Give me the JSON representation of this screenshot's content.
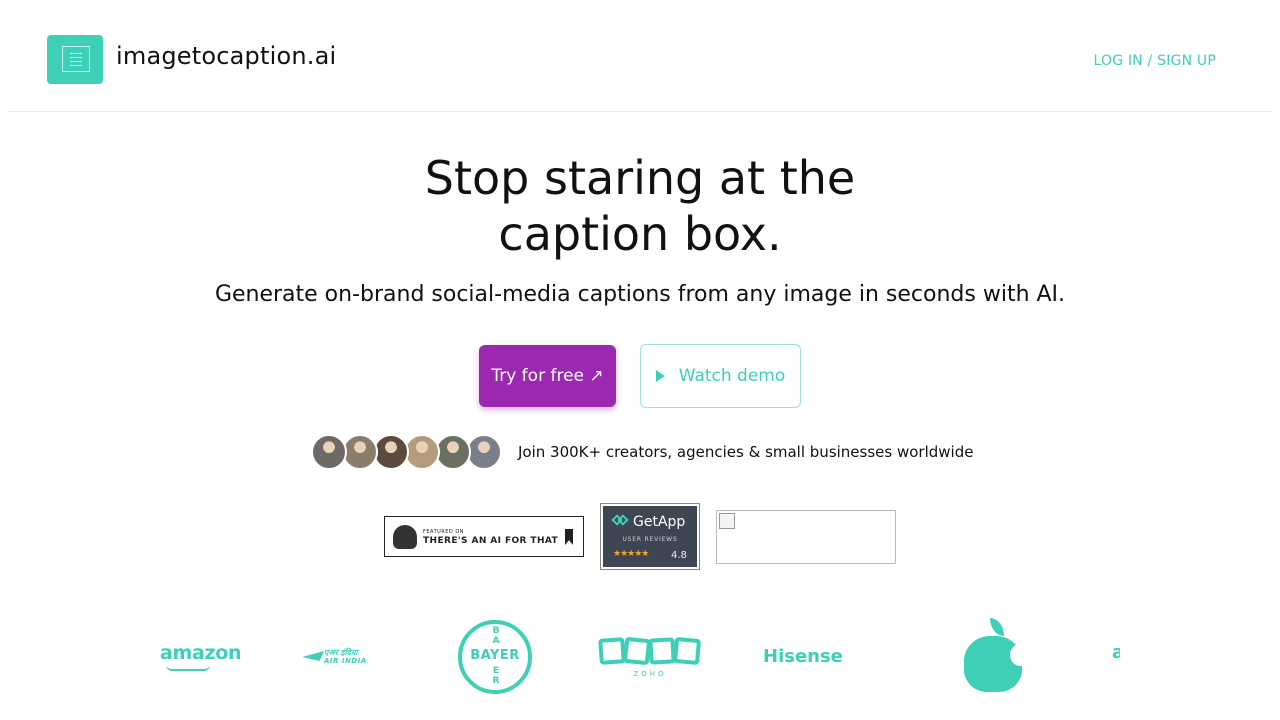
{
  "header": {
    "brand": "imagetocaption.ai",
    "login": "LOG IN / SIGN UP"
  },
  "hero": {
    "headline_line1": "Stop staring at the",
    "headline_line2": "caption box.",
    "subhead": "Generate on-brand social-media captions from any image in seconds with AI.",
    "try_label": "Try for free ↗",
    "demo_label": "Watch demo",
    "social_proof": "Join 300K+ creators, agencies & small businesses worldwide"
  },
  "avatars": [
    {
      "name": "creator-1",
      "color": "#6d6a66"
    },
    {
      "name": "creator-2",
      "color": "#8a7d6c"
    },
    {
      "name": "creator-3",
      "color": "#5b4a3d"
    },
    {
      "name": "creator-4",
      "color": "#b49b79"
    },
    {
      "name": "creator-5",
      "color": "#6e6f63"
    },
    {
      "name": "creator-6",
      "color": "#7b7f8a"
    }
  ],
  "badges": {
    "aift_small": "FEATURED ON",
    "aift_big": "THERE'S AN AI FOR THAT",
    "getapp_title": "GetApp",
    "getapp_sub": "USER REVIEWS",
    "getapp_stars": "★★★★★",
    "getapp_rating": "4.8"
  },
  "logos": {
    "amazon": "amazon",
    "airindia_1": "एअर इंडिया",
    "airindia_2": "AIR INDIA",
    "bayer_h": "BAYER",
    "bayer_v_top": "B A",
    "bayer_v_bottom": "E R",
    "zoho": "ZOHO",
    "hisense": "Hisense",
    "cutoff": "a"
  },
  "colors": {
    "accent": "#3ecfb7",
    "primary_button": "#9c27b0"
  }
}
